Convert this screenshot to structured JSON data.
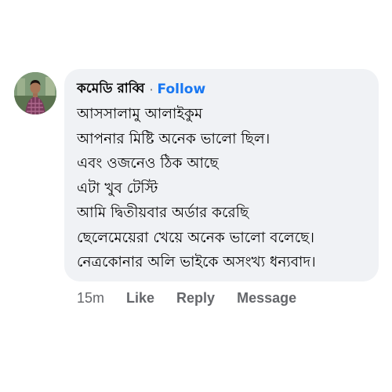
{
  "comment": {
    "author": "কমেডি রাব্বি",
    "separator": "·",
    "follow_label": "Follow",
    "lines": [
      "আসসালামু আলাইকুম",
      "আপনার মিষ্টি অনেক ভালো ছিল।",
      "এবং ওজনেও ঠিক আছে",
      "এটা খুব টেস্টি",
      "আমি দ্বিতীয়বার অর্ডার করেছি",
      "ছেলেমেয়েরা  খেয়ে অনেক ভালো বলেছে।",
      "নেত্রকোনার অলি ভাইকে অসংখ্য ধন্যবাদ।"
    ],
    "timestamp": "15m",
    "like_label": "Like",
    "reply_label": "Reply",
    "message_label": "Message"
  },
  "colors": {
    "bubble": "#f0f2f5",
    "text": "#050505",
    "link": "#1877f2",
    "meta": "#65676b"
  },
  "icons": {
    "avatar": "profile-photo"
  }
}
